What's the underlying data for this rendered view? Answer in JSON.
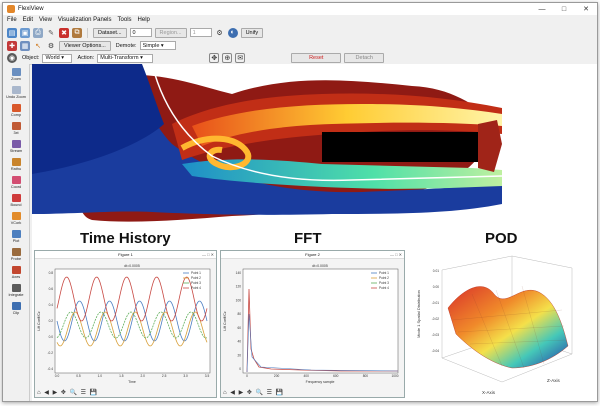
{
  "app": {
    "title": "FlexiView"
  },
  "window_buttons": [
    "—",
    "□",
    "✕"
  ],
  "menu": [
    "File",
    "Edit",
    "View",
    "Visualization Panels",
    "Tools",
    "Help"
  ],
  "toolbar1": {
    "dataset_label": "Dataset...",
    "dataset_value": "0",
    "region_label": "Region...",
    "region_value": "1",
    "unify_label": "Unify"
  },
  "toolbar2": {
    "viewer_options_label": "Viewer Options...",
    "demote_label": "Demote:",
    "demote_value": "Simple"
  },
  "toolbar3": {
    "object_label": "Object:",
    "object_value": "World",
    "action_label": "Action:",
    "action_value": "Multi-Transform",
    "reset_label": "Reset",
    "detach_label": "Detach"
  },
  "sidebar": [
    {
      "label": "Zoom",
      "color": "#6a8fc0"
    },
    {
      "label": "Undo Zoom",
      "color": "#a9b7cc"
    },
    {
      "label": "Comp",
      "color": "#d9582b"
    },
    {
      "label": "3xt",
      "color": "#c05a35"
    },
    {
      "label": "Stream",
      "color": "#7a5aa8"
    },
    {
      "label": "Rathu",
      "color": "#c9842c"
    },
    {
      "label": "Coord",
      "color": "#d34e72"
    },
    {
      "label": "Bound",
      "color": "#cf3b3b"
    },
    {
      "label": "VCork",
      "color": "#e28b2a"
    },
    {
      "label": "Plot",
      "color": "#4d7fbf"
    },
    {
      "label": "Probe",
      "color": "#9a6b3e"
    },
    {
      "label": "Axes",
      "color": "#c2462e"
    },
    {
      "label": "Integrate",
      "color": "#5a5a5a"
    },
    {
      "label": "Clip",
      "color": "#3d6eb0"
    }
  ],
  "panels": {
    "time_history": {
      "title": "Time History",
      "window_title": "Figure 1",
      "plot_title": "dt=0.0005",
      "ylabel": "Lift Coeff/Cz",
      "xlabel": "Time",
      "legend": [
        "Point 1",
        "Point 2",
        "Point 3",
        "Point 4"
      ],
      "colors": [
        "#4a7dc2",
        "#d8a03a",
        "#5fae5a",
        "#c84a44"
      ],
      "xticks": [
        "0.0",
        "0.5",
        "1.0",
        "1.5",
        "2.0",
        "2.5",
        "3.0",
        "3.5"
      ],
      "yticks": [
        "0.8",
        "0.6",
        "0.4",
        "0.2",
        "0.0",
        "-0.2",
        "-0.4"
      ]
    },
    "fft": {
      "title": "FFT",
      "window_title": "Figure 2",
      "plot_title": "dt=0.0005",
      "ylabel": "Lift Coeff/Cz",
      "xlabel": "Frequency sample",
      "legend": [
        "Point 1",
        "Point 2",
        "Point 3",
        "Point 4"
      ],
      "colors": [
        "#4a7dc2",
        "#d8a03a",
        "#5fae5a",
        "#c84a44"
      ],
      "xticks": [
        "0",
        "200",
        "400",
        "600",
        "800",
        "1000"
      ],
      "yticks": [
        "140",
        "120",
        "100",
        "80",
        "60",
        "40",
        "20",
        "0"
      ]
    },
    "pod": {
      "title": "POD",
      "zlabel": "Mode 1 Spatial Distribution",
      "xlabel": "X-Axis",
      "ylabel": "Z-Axis",
      "zticks": [
        "0.01",
        "0.00",
        "-0.01",
        "-0.02",
        "-0.03",
        "-0.04"
      ]
    }
  },
  "figure_toolbar": "⌂ ◀ ▶ ✥ 🔍 ☰ 💾",
  "colors": {
    "accent": "#3d6eb0",
    "reset_red": "#cc2222"
  }
}
